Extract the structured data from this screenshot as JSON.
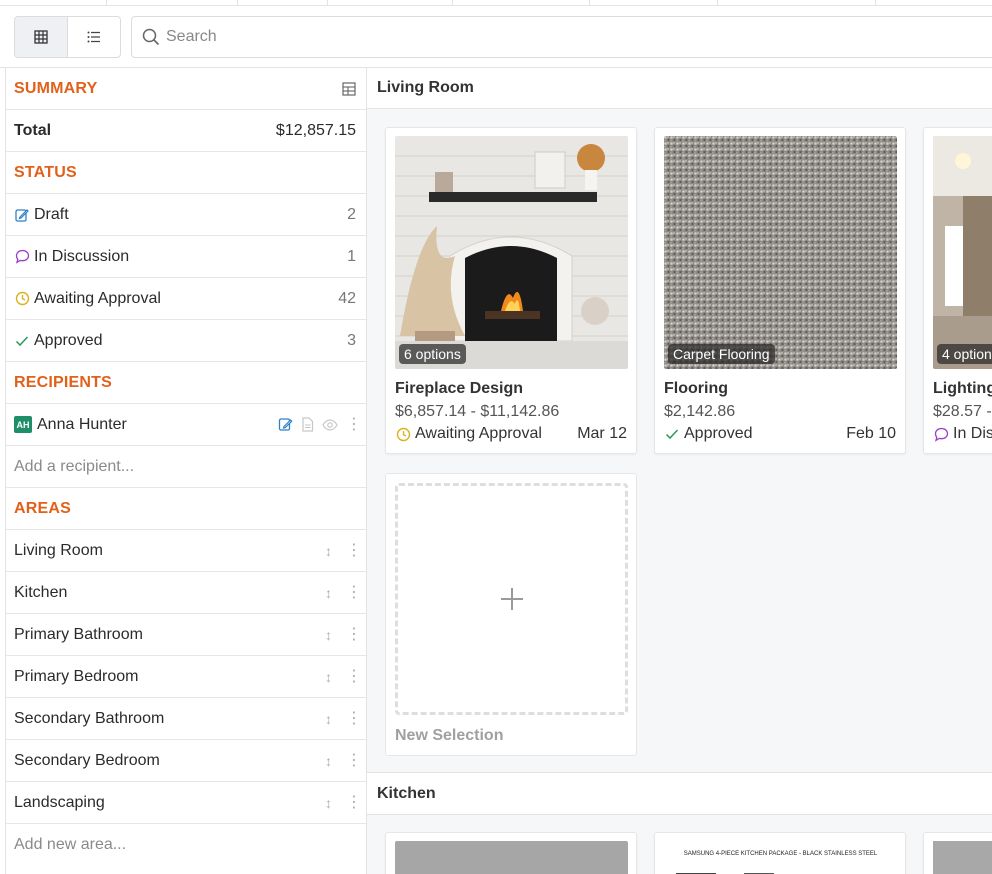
{
  "toolbar": {
    "search_placeholder": "Search"
  },
  "summary": {
    "heading": "SUMMARY",
    "total_label": "Total",
    "total_value": "$12,857.15"
  },
  "status": {
    "heading": "STATUS",
    "items": [
      {
        "label": "Draft",
        "count": "2",
        "icon": "edit-icon",
        "color": "#2f80c8"
      },
      {
        "label": "In Discussion",
        "count": "1",
        "icon": "chat-bubble-icon",
        "color": "#9b3fc9"
      },
      {
        "label": "Awaiting Approval",
        "count": "42",
        "icon": "clock-icon",
        "color": "#d9b21b"
      },
      {
        "label": "Approved",
        "count": "3",
        "icon": "check-icon",
        "color": "#2a9a5a"
      }
    ]
  },
  "recipients": {
    "heading": "RECIPIENTS",
    "items": [
      {
        "initials": "AH",
        "name": "Anna Hunter"
      }
    ],
    "add_placeholder": "Add a recipient..."
  },
  "areas": {
    "heading": "AREAS",
    "items": [
      {
        "label": "Living Room"
      },
      {
        "label": "Kitchen"
      },
      {
        "label": "Primary Bathroom"
      },
      {
        "label": "Primary Bedroom"
      },
      {
        "label": "Secondary Bathroom"
      },
      {
        "label": "Secondary Bedroom"
      },
      {
        "label": "Landscaping"
      }
    ],
    "add_placeholder": "Add new area..."
  },
  "main": {
    "sections": [
      {
        "title": "Living Room",
        "cards": [
          {
            "badge": "6 options",
            "title": "Fireplace Design",
            "price": "$6,857.14 - $11,142.86",
            "status": "Awaiting Approval",
            "status_icon": "clock-icon",
            "date": "Mar 12"
          },
          {
            "badge": "Carpet Flooring",
            "title": "Flooring",
            "price": "$2,142.86",
            "status": "Approved",
            "status_icon": "check-icon",
            "date": "Feb 10"
          },
          {
            "badge": "4 option",
            "title": "Lighting",
            "price": "$28.57 -",
            "status": "In Dis",
            "status_icon": "chat-bubble-icon",
            "date": ""
          }
        ],
        "new_selection_label": "New Selection"
      },
      {
        "title": "Kitchen",
        "cards": [
          {
            "image_caption": "SAMSUNG 4-PIECE KITCHEN PACKAGE - BLACK STAINLESS STEEL"
          }
        ]
      }
    ]
  },
  "colors": {
    "accent": "#e2611a",
    "draft": "#2f80c8",
    "discussion": "#9b3fc9",
    "awaiting": "#d9b21b",
    "approved": "#2a9a5a"
  }
}
